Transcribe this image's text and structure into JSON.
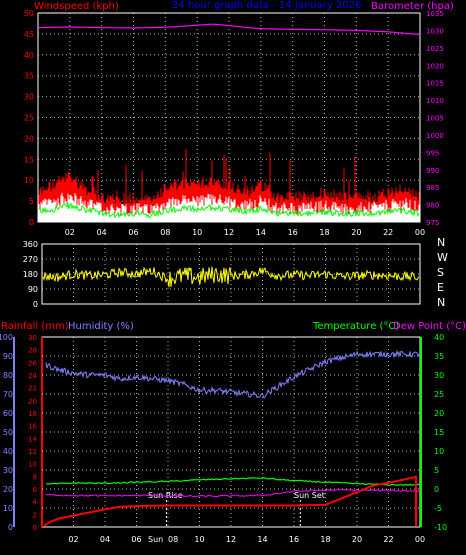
{
  "title": "24 hour graph data - 14 January 2026",
  "colors": {
    "wind": "#ff0000",
    "gust": "#ffffff",
    "avg_wind": "#00ff00",
    "barometer": "#ff00ff",
    "direction": "#ffff00",
    "rain": "#ff0000",
    "humidity": "#8080ff",
    "temperature": "#00ff00",
    "dew_point": "#ff00ff",
    "grid": "#ffffff",
    "axis_labels_left": "#ff0000",
    "title": "#0000ff"
  },
  "chart_data": [
    {
      "type": "line",
      "ylabel_left": "Windspeed (kph)",
      "ylabel_right": "Barometer (hpa)",
      "x_ticks": [
        "02",
        "04",
        "06",
        "08",
        "10",
        "12",
        "14",
        "16",
        "18",
        "20",
        "22",
        "00"
      ],
      "y_left_ticks": [
        "0",
        "5",
        "10",
        "15",
        "20",
        "25",
        "30",
        "35",
        "40",
        "45",
        "50"
      ],
      "ylim_left": [
        0,
        50
      ],
      "y_right_ticks": [
        "975",
        "980",
        "985",
        "990",
        "995",
        "1000",
        "1005",
        "1010",
        "1015",
        "1020",
        "1025",
        "1030",
        "1035"
      ],
      "ylim_right": [
        975,
        1035
      ],
      "grid": true,
      "series": [
        {
          "name": "Barometer",
          "axis": "right",
          "x": [
            0,
            2,
            4,
            6,
            8,
            9,
            10,
            11,
            12,
            13,
            14,
            16,
            18,
            20,
            22,
            24
          ],
          "values": [
            1030.8,
            1031,
            1030.8,
            1030.7,
            1030.9,
            1031.2,
            1031.5,
            1031.8,
            1031.4,
            1030.9,
            1030.5,
            1030.3,
            1030.2,
            1030,
            1029.6,
            1028.8
          ]
        },
        {
          "name": "Windspeed",
          "axis": "left",
          "x": [
            0,
            1,
            2,
            3,
            4,
            5,
            6,
            7,
            8,
            9,
            10,
            11,
            12,
            13,
            14,
            15,
            16,
            17,
            18,
            19,
            20,
            21,
            22,
            23,
            24
          ],
          "values": [
            7,
            9,
            11,
            8,
            6,
            5,
            6,
            5,
            8,
            9,
            9,
            10,
            9,
            7,
            9,
            6,
            6,
            6,
            7,
            6,
            6,
            6,
            7,
            8,
            6
          ]
        }
      ]
    },
    {
      "type": "scatter",
      "ylabel_right": [
        "N",
        "W",
        "S",
        "E",
        "N"
      ],
      "y_left_ticks": [
        "0",
        "90",
        "180",
        "270",
        "360"
      ],
      "ylim": [
        0,
        360
      ],
      "x_ticks": [
        "02",
        "04",
        "06",
        "08",
        "10",
        "12",
        "14",
        "16",
        "18",
        "20",
        "22",
        "00"
      ],
      "grid": true,
      "series": [
        {
          "name": "Wind direction",
          "x": [
            0,
            1,
            2,
            3,
            4,
            5,
            6,
            7,
            8,
            9,
            10,
            11,
            12,
            13,
            14,
            15,
            16,
            17,
            18,
            19,
            20,
            21,
            22,
            23,
            24
          ],
          "values": [
            170,
            160,
            180,
            170,
            175,
            190,
            180,
            200,
            150,
            170,
            160,
            180,
            170,
            175,
            200,
            170,
            175,
            170,
            180,
            165,
            170,
            175,
            170,
            165,
            160
          ]
        }
      ]
    },
    {
      "type": "line",
      "ylabel_left_1": "Rainfall (mm)",
      "ylabel_left_2": "Humidity (%)",
      "ylabel_right_1": "Temperature (°C)",
      "ylabel_right_2": "Dew Point (°C)",
      "x_ticks": [
        "02",
        "04",
        "06",
        "08",
        "10",
        "12",
        "14",
        "16",
        "18",
        "20",
        "22",
        "00"
      ],
      "humidity_ticks": [
        "0",
        "10",
        "20",
        "30",
        "40",
        "50",
        "60",
        "70",
        "80",
        "90",
        "100"
      ],
      "ylim_humidity": [
        0,
        100
      ],
      "rain_ticks": [
        "0",
        "2",
        "4",
        "6",
        "8",
        "10",
        "12",
        "14",
        "16",
        "18",
        "20",
        "22",
        "24",
        "26",
        "28",
        "30"
      ],
      "ylim_rain": [
        0,
        30
      ],
      "temp_ticks": [
        "-10",
        "-5",
        "0",
        "5",
        "10",
        "15",
        "20",
        "25",
        "30",
        "35",
        "40"
      ],
      "ylim_temp": [
        -10,
        40
      ],
      "annotations": [
        "Sun Rise",
        "Sun Set",
        "Sun"
      ],
      "grid": true,
      "series": [
        {
          "name": "Humidity",
          "axis": "humidity",
          "x": [
            0,
            1,
            2,
            3,
            4,
            5,
            6,
            7,
            8,
            9,
            10,
            11,
            12,
            13,
            14,
            15,
            16,
            17,
            18,
            19,
            20,
            21,
            22,
            23,
            24
          ],
          "values": [
            86,
            83,
            81,
            80,
            80,
            78,
            79,
            78,
            77,
            75,
            72,
            72,
            71,
            70,
            69,
            74,
            79,
            83,
            87,
            89,
            91,
            91,
            91,
            91,
            91
          ]
        },
        {
          "name": "Temperature",
          "axis": "temp",
          "x": [
            0,
            2,
            4,
            6,
            8,
            10,
            12,
            13,
            14,
            15,
            16,
            18,
            20,
            22,
            24
          ],
          "values": [
            1.2,
            1.6,
            1.5,
            1.8,
            2.0,
            2.4,
            2.7,
            2.8,
            2.9,
            2.5,
            2.2,
            1.8,
            1.4,
            1.1,
            1.1
          ]
        },
        {
          "name": "Dew Point",
          "axis": "temp",
          "x": [
            0,
            2,
            4,
            6,
            8,
            10,
            12,
            14,
            16,
            18,
            20,
            22,
            24
          ],
          "values": [
            -1.5,
            -1.7,
            -1.8,
            -1.7,
            -1.8,
            -1.9,
            -1.8,
            -1.7,
            -0.6,
            -0.3,
            -0.3,
            -0.4,
            -0.5
          ]
        },
        {
          "name": "Rainfall",
          "axis": "rain",
          "x": [
            0,
            0.5,
            1,
            2,
            3,
            4,
            5,
            6,
            8,
            10,
            12,
            14,
            16,
            18,
            19,
            20,
            21,
            22,
            23,
            23.9,
            24
          ],
          "values": [
            0,
            0.8,
            1.3,
            1.8,
            2.3,
            2.8,
            3.2,
            3.3,
            3.4,
            3.4,
            3.4,
            3.4,
            3.4,
            3.5,
            4.5,
            5.5,
            6.5,
            7,
            7.5,
            8,
            0
          ]
        }
      ]
    }
  ]
}
